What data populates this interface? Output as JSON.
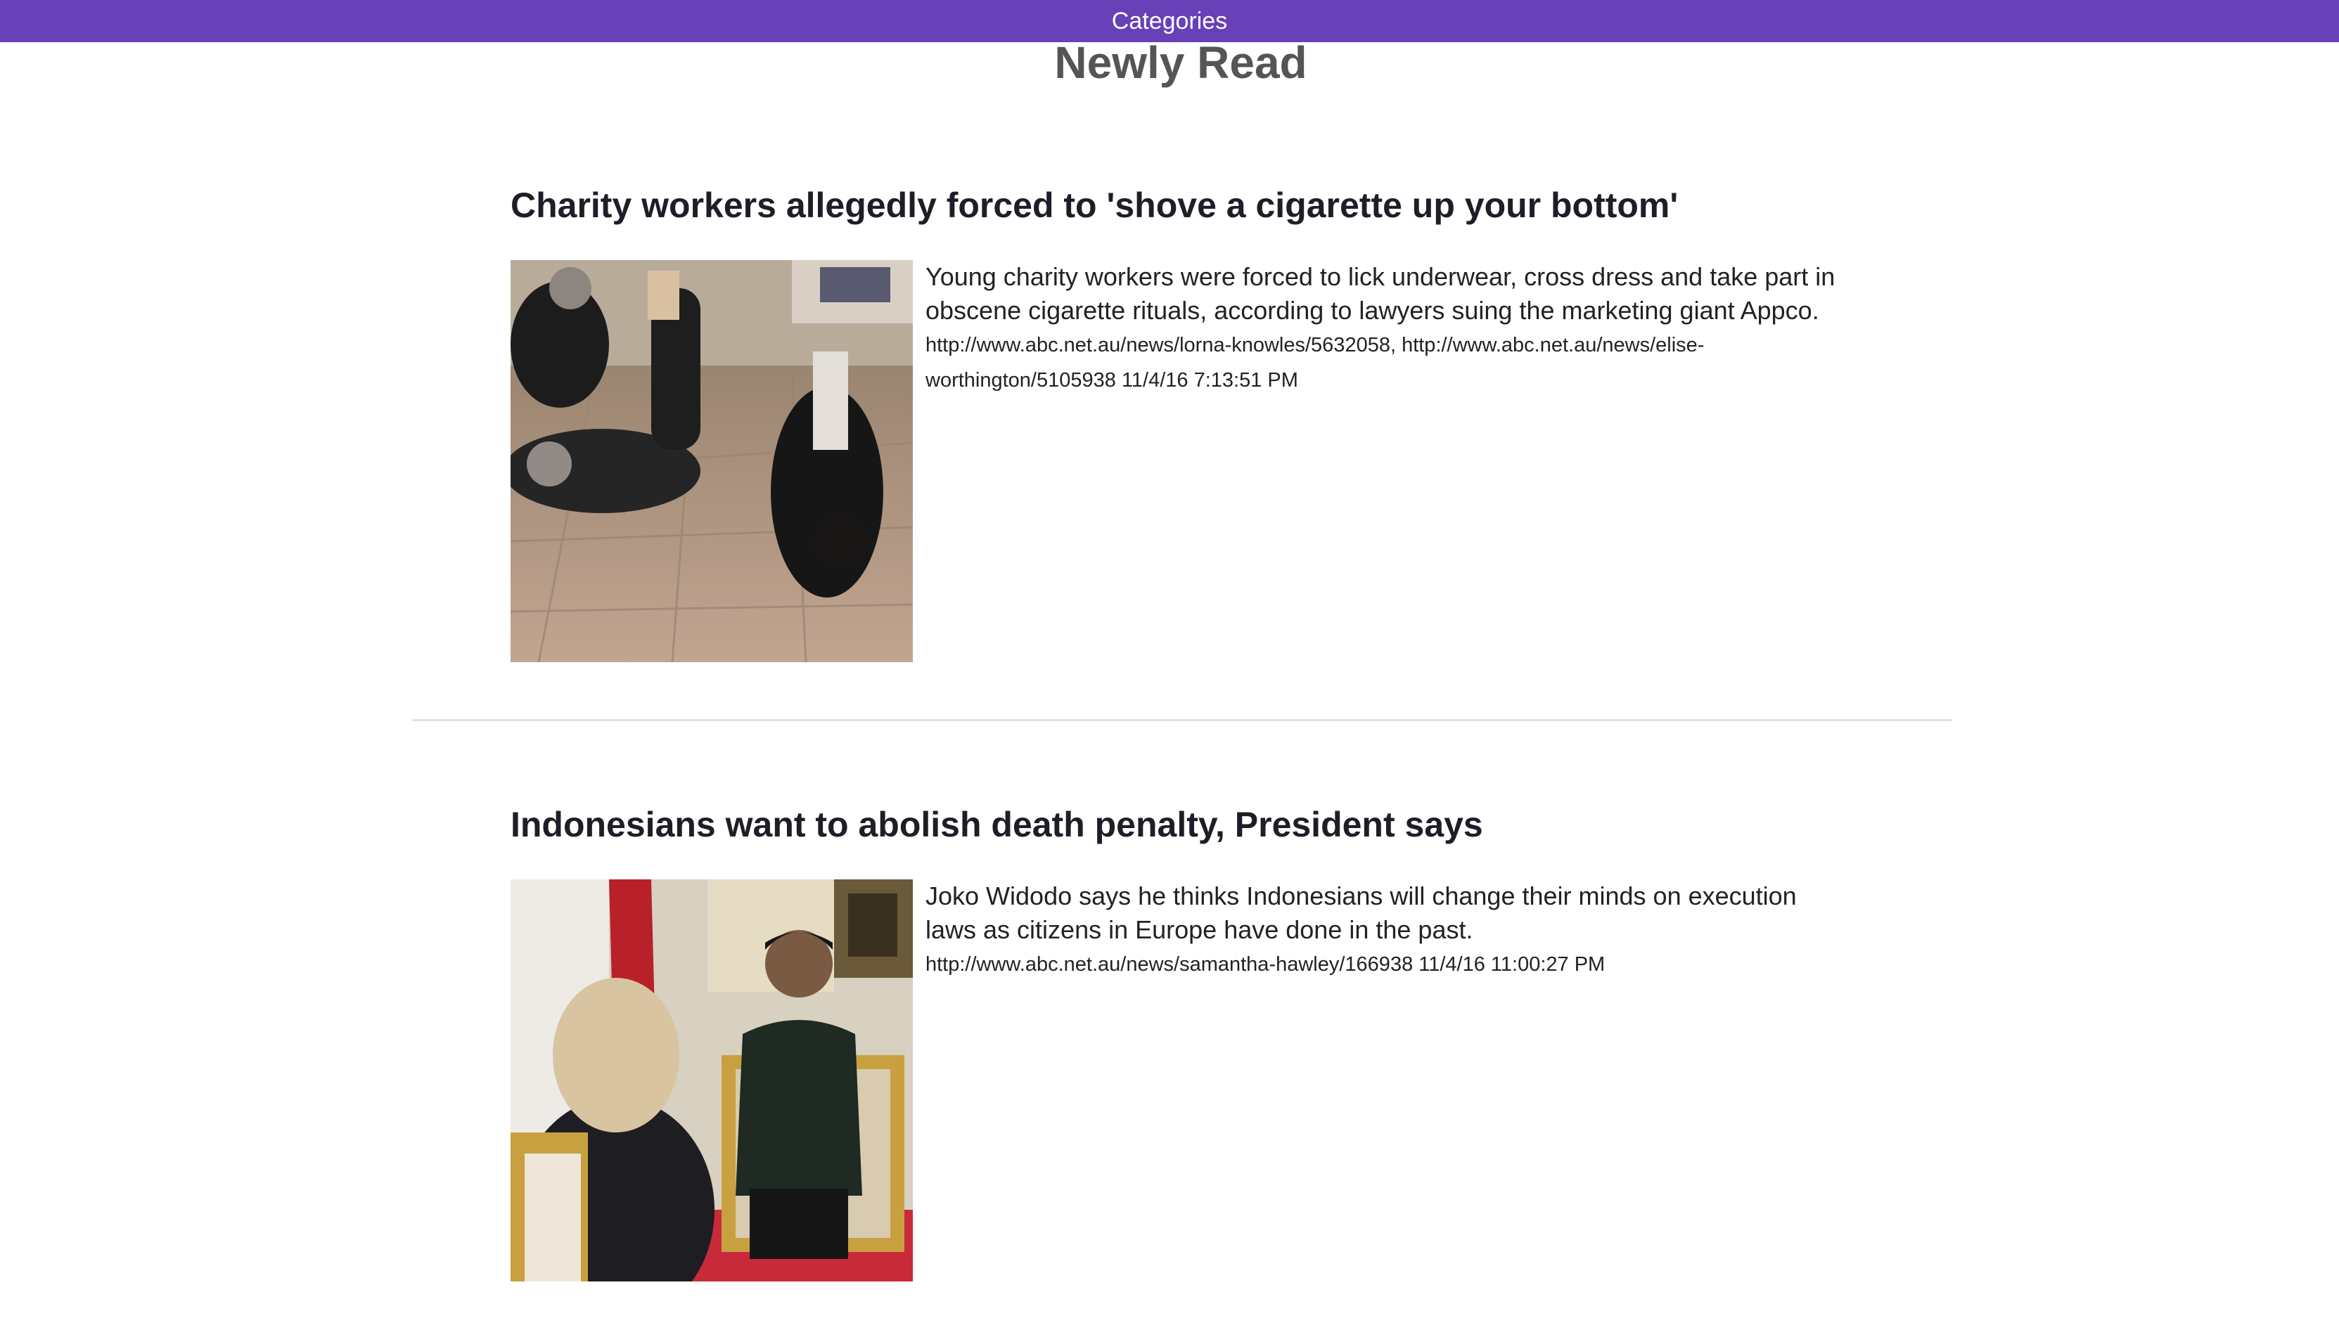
{
  "nav": {
    "categories_label": "Categories"
  },
  "page": {
    "title": "Newly Read"
  },
  "articles": [
    {
      "title": "Charity workers allegedly forced to 'shove a cigarette up your bottom'",
      "summary": "Young charity workers were forced to lick underwear, cross dress and take part in obscene cigarette rituals, according to lawyers suing the marketing giant Appco.",
      "meta": "http://www.abc.net.au/news/lorna-knowles/5632058, http://www.abc.net.au/news/elise-worthington/5105938 11/4/16 7:13:51 PM"
    },
    {
      "title": "Indonesians want to abolish death penalty, President says",
      "summary": "Joko Widodo says he thinks Indonesians will change their minds on execution laws as citizens in Europe have done in the past.",
      "meta": "http://www.abc.net.au/news/samantha-hawley/166938 11/4/16 11:00:27 PM"
    }
  ]
}
